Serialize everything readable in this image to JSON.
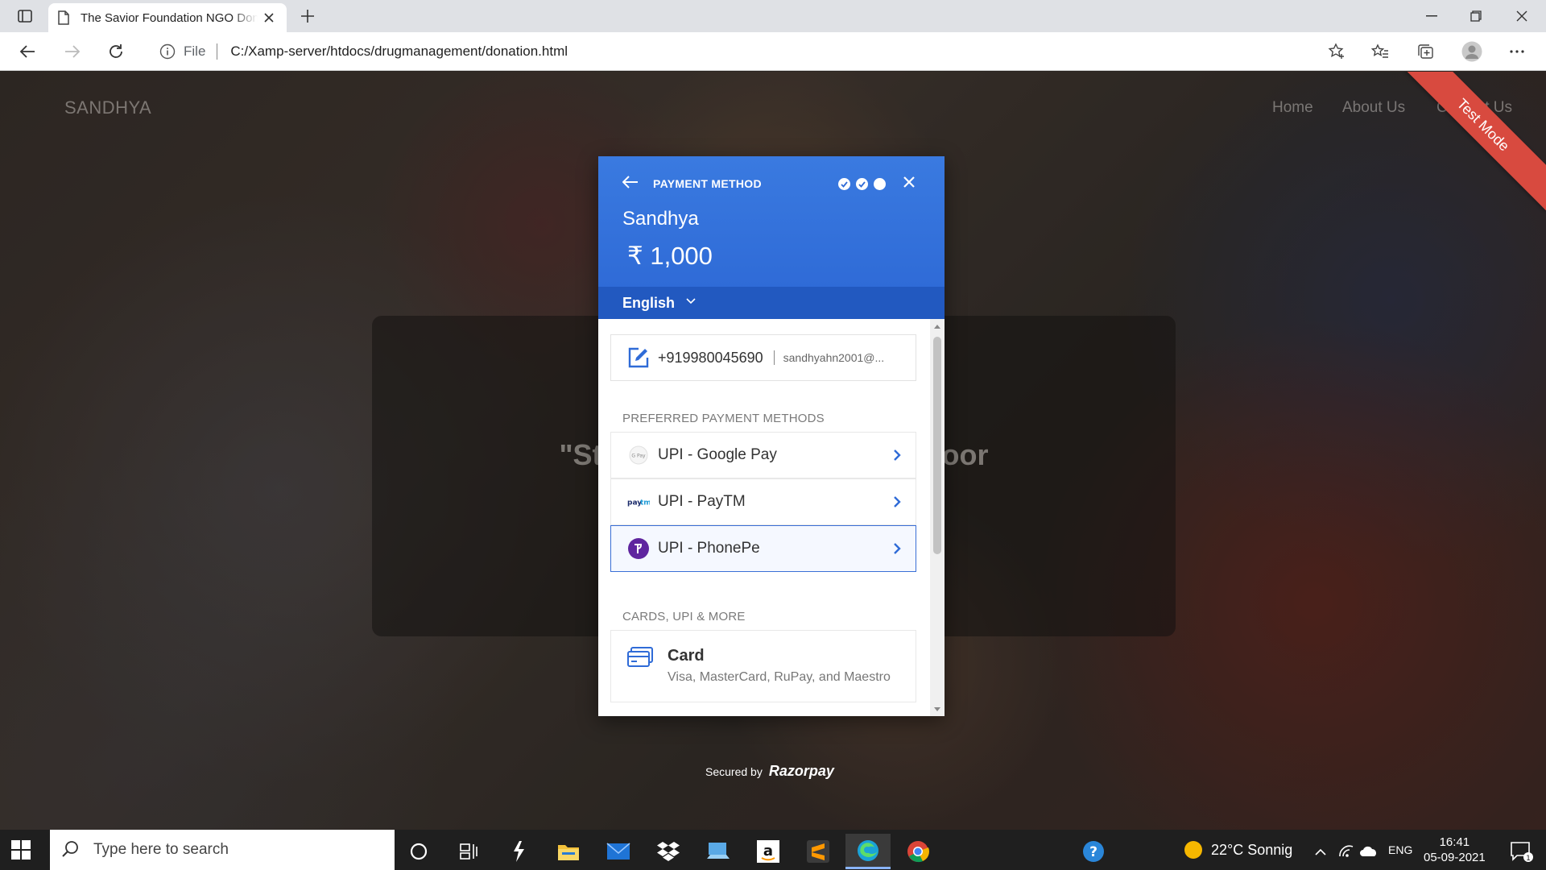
{
  "browser": {
    "tab_title": "The Savior Foundation NGO Donation",
    "address_prefix": "File",
    "url": "C:/Xamp-server/htdocs/drugmanagement/donation.html"
  },
  "site": {
    "brand": "SANDHYA",
    "nav": [
      "Home",
      "About Us",
      "Contact Us"
    ],
    "hero_text": "\"Start Fundraising to help poor",
    "ribbon": "Test Mode",
    "secured_by": "Secured by",
    "secured_brand": "Razorpay"
  },
  "modal": {
    "header_title": "PAYMENT METHOD",
    "merchant_name": "Sandhya",
    "amount": "₹ 1,000",
    "language": "English",
    "contact_phone": "+919980045690",
    "contact_email": "sandhyahn2001@...",
    "preferred_heading": "PREFERRED PAYMENT METHODS",
    "preferred_options": [
      {
        "label": "UPI - Google Pay",
        "icon": "google-pay-icon"
      },
      {
        "label": "UPI - PayTM",
        "icon": "paytm-icon"
      },
      {
        "label": "UPI - PhonePe",
        "icon": "phonepe-icon",
        "selected": true
      }
    ],
    "more_heading": "CARDS, UPI & MORE",
    "card_title": "Card",
    "card_subtitle": "Visa, MasterCard, RuPay, and Maestro",
    "accent_color": "#3a7ae0"
  },
  "taskbar": {
    "search_placeholder": "Type here to search",
    "weather": "22°C Sonnig",
    "language": "ENG",
    "time": "16:41",
    "date": "05-09-2021",
    "notification_count": "1"
  }
}
